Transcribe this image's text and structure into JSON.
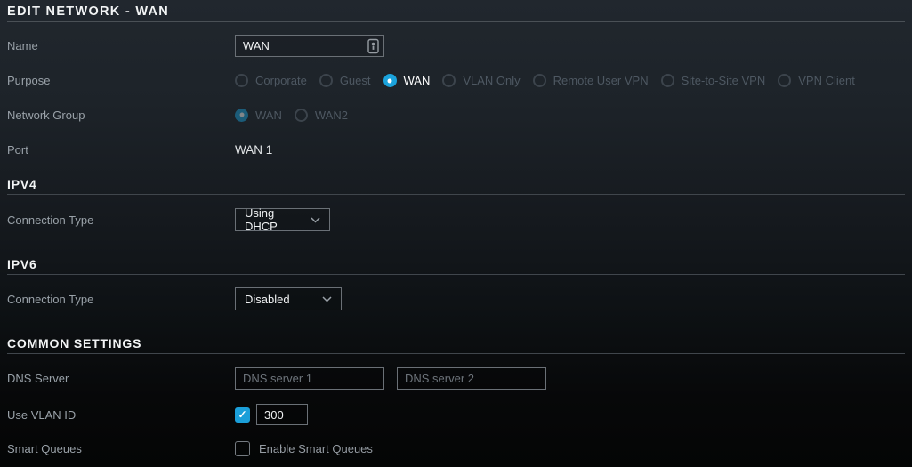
{
  "title": "EDIT NETWORK - WAN",
  "accent_color": "#1b9fd9",
  "name": {
    "label": "Name",
    "value": "WAN"
  },
  "purpose": {
    "label": "Purpose",
    "selected": "WAN",
    "options": [
      {
        "label": "Corporate"
      },
      {
        "label": "Guest"
      },
      {
        "label": "WAN"
      },
      {
        "label": "VLAN Only"
      },
      {
        "label": "Remote User VPN"
      },
      {
        "label": "Site-to-Site VPN"
      },
      {
        "label": "VPN Client"
      }
    ]
  },
  "network_group": {
    "label": "Network Group",
    "selected": "WAN",
    "options": [
      {
        "label": "WAN"
      },
      {
        "label": "WAN2"
      }
    ]
  },
  "port": {
    "label": "Port",
    "value": "WAN 1"
  },
  "ipv4": {
    "heading": "IPV4",
    "connection_type": {
      "label": "Connection Type",
      "value": "Using DHCP"
    }
  },
  "ipv6": {
    "heading": "IPV6",
    "connection_type": {
      "label": "Connection Type",
      "value": "Disabled"
    }
  },
  "common": {
    "heading": "COMMON SETTINGS",
    "dns": {
      "label": "DNS Server",
      "placeholder1": "DNS server 1",
      "placeholder2": "DNS server 2",
      "value1": "",
      "value2": ""
    },
    "vlan": {
      "label": "Use VLAN ID",
      "checked": true,
      "value": "300"
    },
    "smart_queues": {
      "label": "Smart Queues",
      "checkbox_label": "Enable Smart Queues",
      "checked": false
    }
  }
}
